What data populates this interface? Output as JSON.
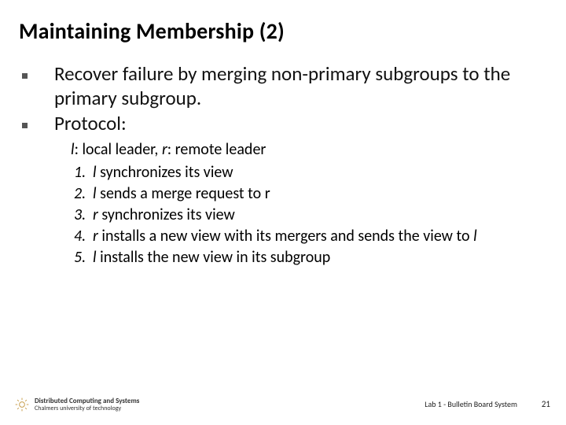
{
  "title": "Maintaining Membership (2)",
  "points": {
    "p1": "Recover failure by merging non-primary subgroups to the primary subgroup.",
    "p2": "Protocol:"
  },
  "leaders": {
    "l_name": "l",
    "l_desc": ": local leader, ",
    "r_name": "r",
    "r_desc": ": remote leader"
  },
  "steps": {
    "s1": {
      "num": "1.",
      "pre": "l ",
      "text": "synchronizes its view"
    },
    "s2": {
      "num": "2.",
      "pre": "l ",
      "text": "sends a merge request to r"
    },
    "s3": {
      "num": "3.",
      "pre": "r ",
      "text": "synchronizes its view"
    },
    "s4": {
      "num": "4.",
      "pre": " r ",
      "text_a": "installs a new view with its mergers and sends the view to ",
      "tail": "l"
    },
    "s5": {
      "num": "5.",
      "pre": "l ",
      "text": "installs the new view in its subgroup"
    }
  },
  "footer": {
    "org1": "Distributed Computing and Systems",
    "org2": "Chalmers university of technology",
    "label": "Lab 1 - Bulletin Board System",
    "page": "21"
  }
}
